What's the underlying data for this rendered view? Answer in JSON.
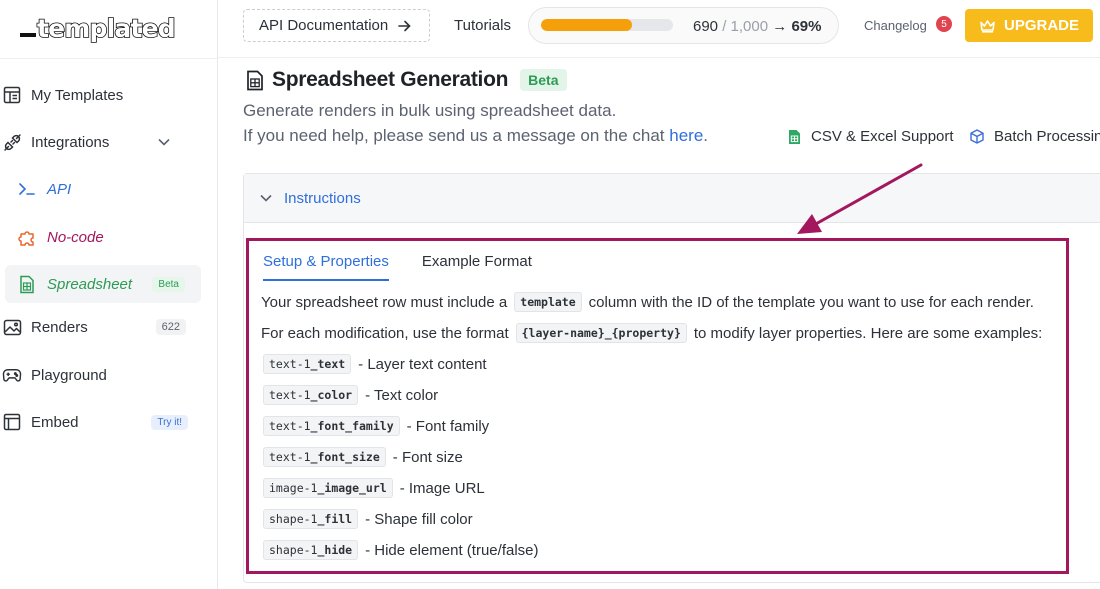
{
  "sidebar": {
    "logo": "templated",
    "items": [
      {
        "label": "My Templates"
      },
      {
        "label": "Integrations"
      },
      {
        "label": "API"
      },
      {
        "label": "No-code"
      },
      {
        "label": "Spreadsheet",
        "badge": "Beta"
      },
      {
        "label": "Renders",
        "badge": "622"
      },
      {
        "label": "Playground"
      },
      {
        "label": "Embed",
        "badge": "Try it!"
      }
    ]
  },
  "topbar": {
    "api_doc_label": "API Documentation",
    "tutorials_label": "Tutorials",
    "usage": {
      "used": "690",
      "separator": " / ",
      "limit": "1,000",
      "arrow": " → ",
      "percent": "69%",
      "fill_fraction": 0.69
    },
    "changelog_label": "Changelog",
    "changelog_count": "5",
    "upgrade_label": "UPGRADE"
  },
  "main": {
    "title": "Spreadsheet Generation",
    "title_badge": "Beta",
    "description_line1": "Generate renders in bulk using spreadsheet data.",
    "description_line2_prefix": "If you need help, please send us a message on the chat ",
    "description_link": "here",
    "description_line2_suffix": ".",
    "features": [
      "CSV & Excel Support",
      "Batch Processing"
    ],
    "instructions": {
      "title": "Instructions",
      "tabs": [
        "Setup & Properties",
        "Example Format"
      ],
      "para1_prefix": "Your spreadsheet row must include a",
      "para1_code": "template",
      "para1_suffix": "column with the ID of the template you want to use for each render.",
      "para2_prefix": "For each modification, use the format",
      "para2_code": "{layer-name}_{property}",
      "para2_suffix": "to modify layer properties. Here are some examples:",
      "examples": [
        {
          "layer": "text-1",
          "prop": "_text",
          "desc": "- Layer text content"
        },
        {
          "layer": "text-1",
          "prop": "_color",
          "desc": "- Text color"
        },
        {
          "layer": "text-1",
          "prop": "_font_family",
          "desc": "- Font family"
        },
        {
          "layer": "text-1",
          "prop": "_font_size",
          "desc": "- Font size"
        },
        {
          "layer": "image-1",
          "prop": "_image_url",
          "desc": "- Image URL"
        },
        {
          "layer": "shape-1",
          "prop": "_fill",
          "desc": "- Shape fill color"
        },
        {
          "layer": "shape-1",
          "prop": "_hide",
          "desc": "- Hide element (true/false)"
        }
      ]
    }
  },
  "colors": {
    "accent": "#2f6fdc",
    "upgrade": "#f7bb1c",
    "highlight": "#a3175e",
    "beta_green": "#2e9b55",
    "progress": "#f5a00b"
  },
  "icons": [
    "template-layout-icon",
    "plug-icon",
    "chevron-down-icon",
    "terminal-icon",
    "puzzle-icon",
    "spreadsheet-icon",
    "image-icon",
    "gamepad-icon",
    "embed-icon",
    "arrow-right-icon",
    "crown-icon",
    "cube-icon"
  ]
}
